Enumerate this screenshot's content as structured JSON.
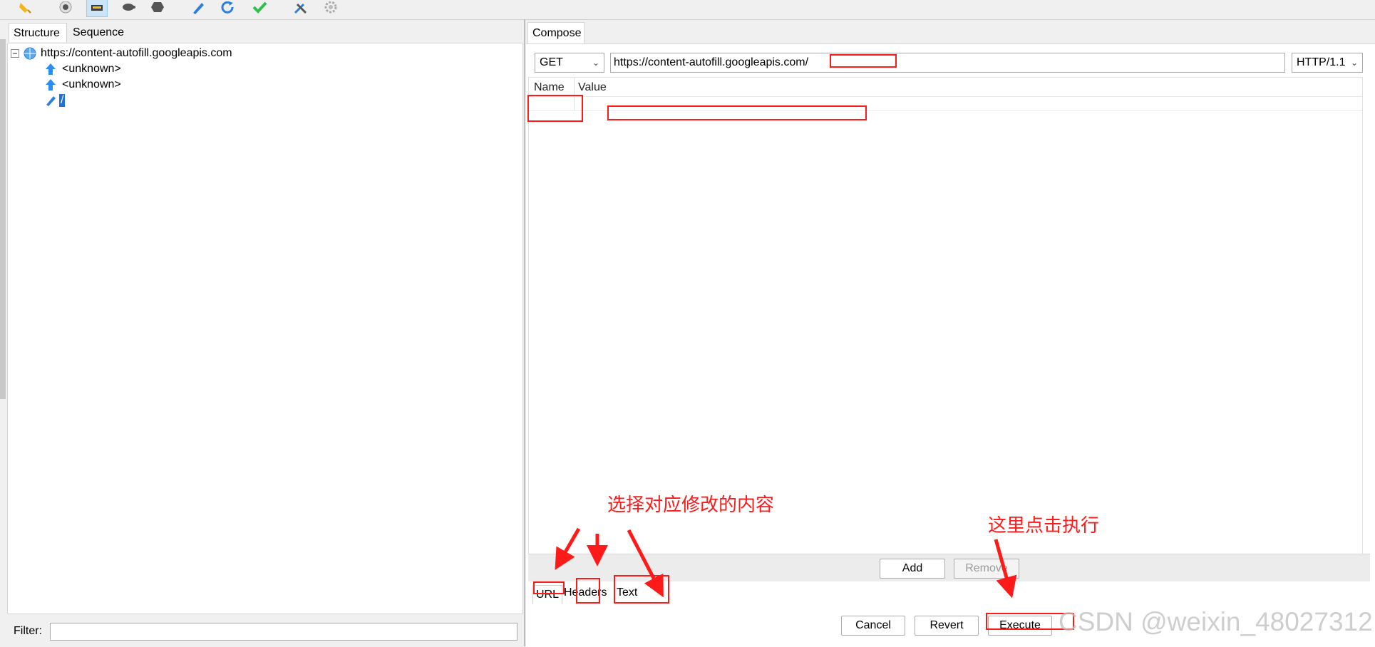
{
  "toolbar": {
    "icons": [
      "broom-icon",
      "record-icon",
      "stop-icon",
      "turtle-icon",
      "hexagon-icon",
      "pen-icon",
      "refresh-icon",
      "check-icon",
      "tools-icon",
      "gear-icon"
    ]
  },
  "left": {
    "tabs": [
      {
        "label": "Structure",
        "selected": true
      },
      {
        "label": "Sequence",
        "selected": false
      }
    ],
    "tree": {
      "host": "https://content-autofill.googleapis.com",
      "children": [
        "<unknown>",
        "<unknown>"
      ],
      "selected_item": "/"
    },
    "filter_label": "Filter:",
    "filter_value": ""
  },
  "right": {
    "tab_label": "Compose",
    "method": "GET",
    "url": "https://content-autofill.googleapis.com/",
    "protocol": "HTTP/1.1",
    "grid_headers": {
      "name": "Name",
      "value": "Value"
    },
    "add_label": "Add",
    "remove_label": "Remove",
    "bottom_tabs": [
      "URL",
      "Headers",
      "Text"
    ],
    "cancel_label": "Cancel",
    "revert_label": "Revert",
    "execute_label": "Execute"
  },
  "annotations": {
    "select_note": "选择对应修改的内容",
    "execute_note": "这里点击执行",
    "color": "#ff1a1a"
  },
  "watermark": "CSDN @weixin_48027312",
  "colors": {
    "accent_selection": "#1e6fe0",
    "annotation": "#ff1a1a"
  }
}
